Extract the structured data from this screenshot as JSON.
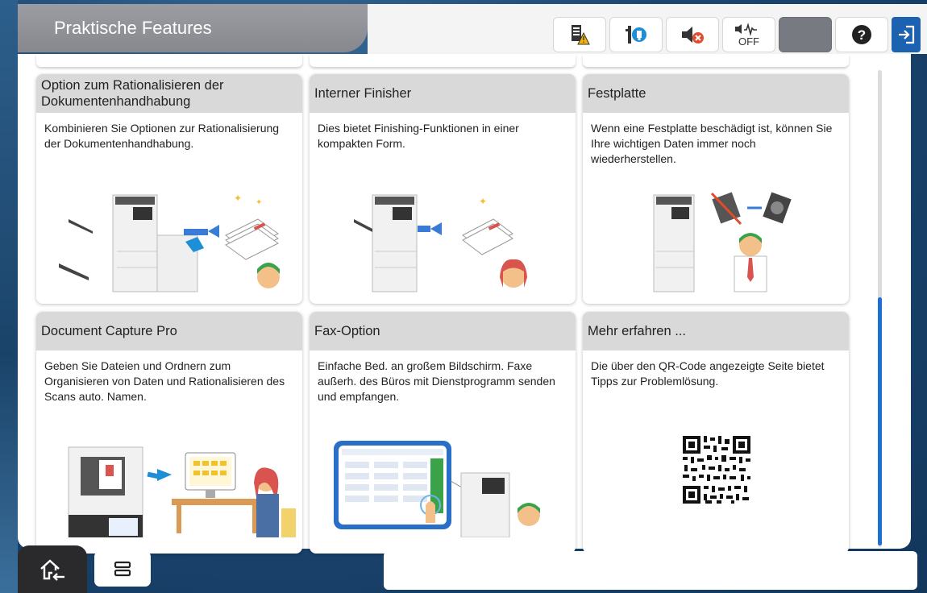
{
  "header": {
    "title": "Praktische Features",
    "toolbar": [
      {
        "icon": "supply-warning-icon"
      },
      {
        "icon": "network-status-icon"
      },
      {
        "icon": "mute-icon"
      },
      {
        "icon": "sound-off-icon",
        "label": "OFF"
      },
      {
        "icon": "sleep-moon-icon"
      },
      {
        "icon": "help-icon",
        "label": "?"
      },
      {
        "icon": "logout-icon"
      }
    ]
  },
  "cards": [
    {
      "title": "Option zum Rationalisieren der Dokumentenhandhabung",
      "desc": "Kombinieren Sie Optionen zur Rationalisierung der Dokumentenhandhabung."
    },
    {
      "title": "Interner Finisher",
      "desc": "Dies bietet Finishing-Funktionen in einer kompakten Form."
    },
    {
      "title": "Festplatte",
      "desc": "Wenn eine Festplatte beschädigt ist, können Sie Ihre wichtigen Daten immer noch wiederherstellen."
    },
    {
      "title": "Document Capture Pro",
      "desc": "Geben Sie Dateien und Ordnern zum Organisieren von Daten und Rationalisieren des Scans auto. Namen."
    },
    {
      "title": "Fax-Option",
      "desc": "Einfache Bed. an großem Bildschirm. Faxe außerh. des Büros mit Dienstprogramm senden und empfangen."
    },
    {
      "title": "Mehr erfahren ...",
      "desc": "Die über den QR-Code angezeigte Seite bietet Tipps zur Problemlösung."
    }
  ],
  "footer": {
    "home_icon": "home-icon",
    "jobs_icon": "job-status-icon"
  },
  "colors": {
    "accent": "#1d6fd0",
    "title_tab": "#8f9196",
    "card_header": "#d9d9d9",
    "logout": "#1d62b0"
  }
}
